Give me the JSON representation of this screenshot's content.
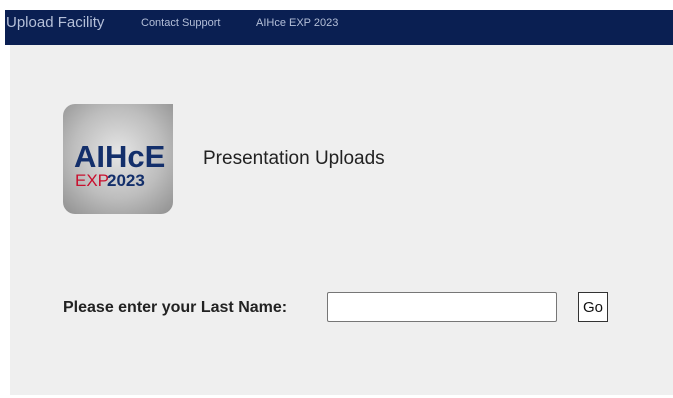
{
  "navbar": {
    "brand": "Upload Facility",
    "links": [
      {
        "label": "Contact Support"
      },
      {
        "label": "AIHce EXP 2023"
      }
    ]
  },
  "logo": {
    "line1": "AIHcE",
    "line2_exp": "EXP",
    "line2_year": "2023",
    "colors": {
      "navy": "#132f6b",
      "red": "#c8102e"
    }
  },
  "page": {
    "title": "Presentation Uploads"
  },
  "form": {
    "label": "Please enter your Last Name:",
    "input_value": "",
    "go_label": "Go"
  },
  "colors": {
    "navbar_bg": "#0a1f52",
    "content_bg": "#efefef"
  }
}
